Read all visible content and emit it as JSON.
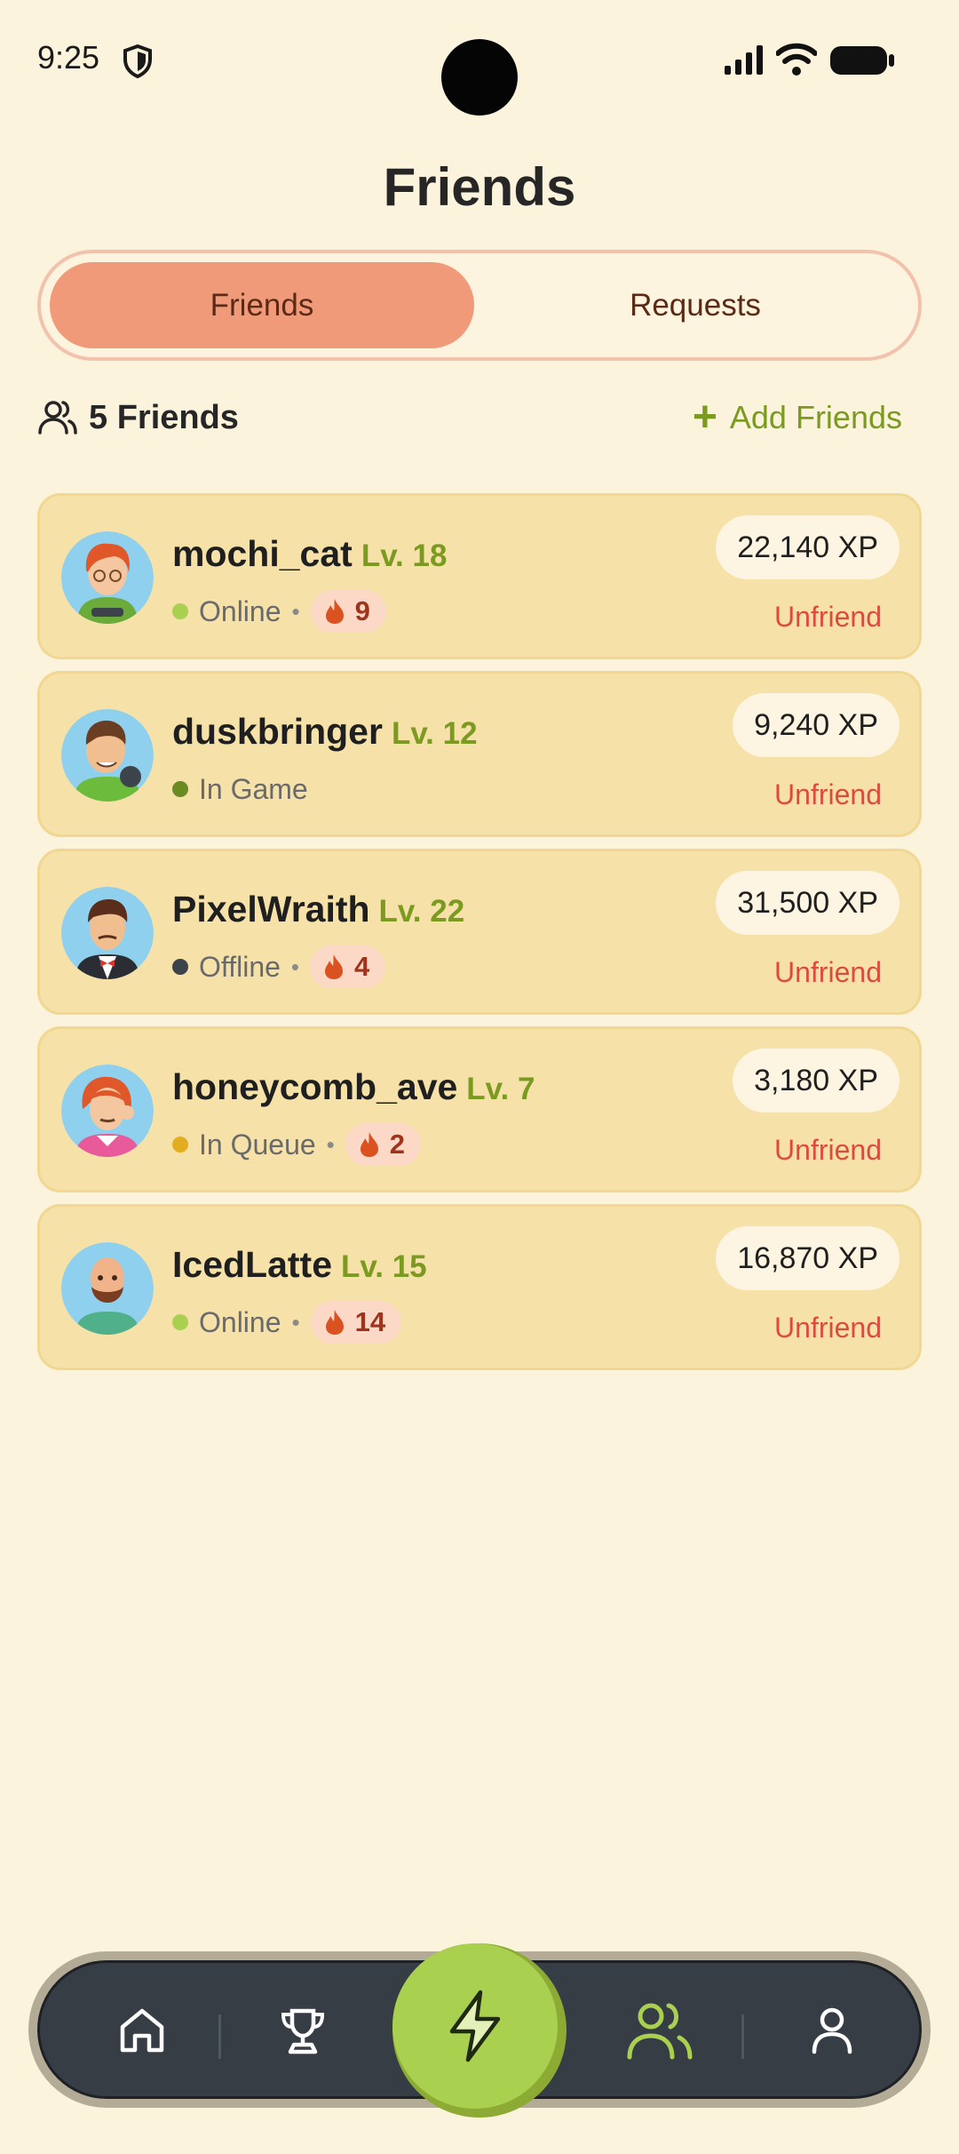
{
  "status_bar": {
    "time": "9:25"
  },
  "title": "Friends",
  "tabs": [
    {
      "label": "Friends",
      "active": true
    },
    {
      "label": "Requests",
      "active": false
    }
  ],
  "summary": {
    "count_label": "5 Friends",
    "add_label": "Add Friends"
  },
  "friends": [
    {
      "name": "mochi_cat",
      "level": "Lv. 18",
      "status": "Online",
      "status_color": "#a9d04f",
      "streak": "9",
      "xp": "22,140 XP",
      "action": "Unfriend"
    },
    {
      "name": "duskbringer",
      "level": "Lv. 12",
      "status": "In Game",
      "status_color": "#6b8a21",
      "streak": "",
      "xp": "9,240 XP",
      "action": "Unfriend"
    },
    {
      "name": "PixelWraith",
      "level": "Lv. 22",
      "status": "Offline",
      "status_color": "#3d434a",
      "streak": "4",
      "xp": "31,500 XP",
      "action": "Unfriend"
    },
    {
      "name": "honeycomb_ave",
      "level": "Lv. 7",
      "status": "In Queue",
      "status_color": "#e3ad22",
      "streak": "2",
      "xp": "3,180 XP",
      "action": "Unfriend"
    },
    {
      "name": "IcedLatte",
      "level": "Lv. 15",
      "status": "Online",
      "status_color": "#a9d04f",
      "streak": "14",
      "xp": "16,870 XP",
      "action": "Unfriend"
    }
  ],
  "nav": {
    "items": [
      {
        "icon": "home-icon",
        "active": false
      },
      {
        "icon": "trophy-icon",
        "active": false
      },
      {
        "icon": "lightning-icon",
        "active": false
      },
      {
        "icon": "friends-icon",
        "active": true
      },
      {
        "icon": "profile-icon",
        "active": false
      }
    ]
  },
  "colors": {
    "accent": "#a9d04f",
    "tab_active": "#f09a7a",
    "card": "#f6e2a8",
    "danger": "#e0493e",
    "level": "#7a9a20"
  }
}
